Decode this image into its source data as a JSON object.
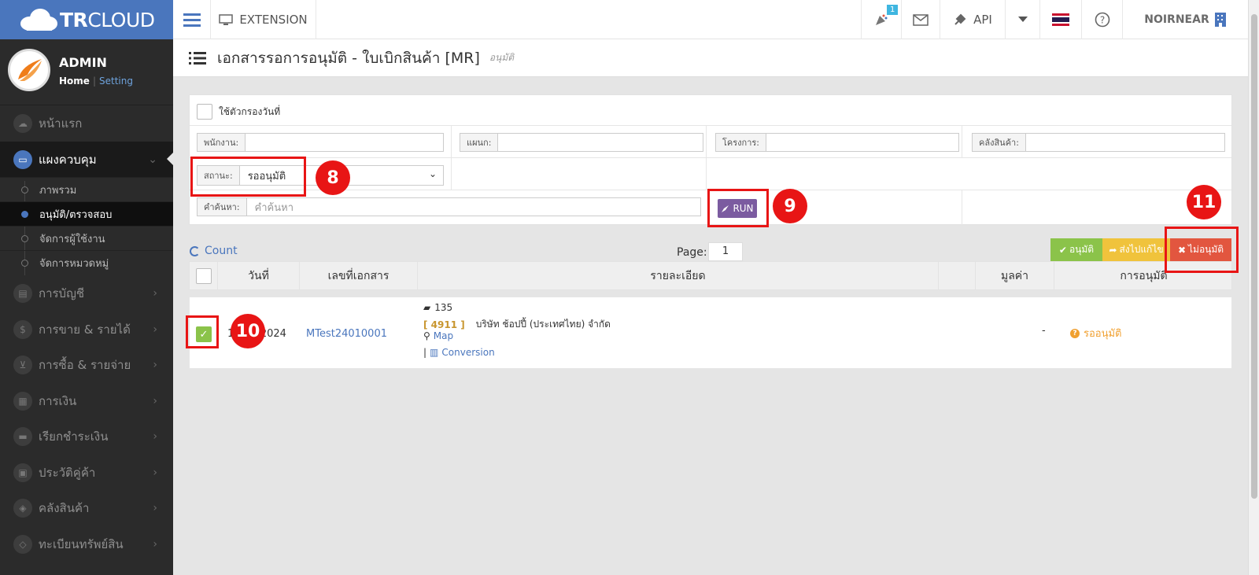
{
  "brand": {
    "prefix": "TR",
    "suffix": "CLOUD"
  },
  "topbar": {
    "extension_label": "EXTENSION",
    "notification_count": "1",
    "api_label": "API",
    "user_label": "NOIRNEAR"
  },
  "profile": {
    "name": "ADMIN",
    "home": "Home",
    "separator": "|",
    "setting": "Setting"
  },
  "sidebar": {
    "items": [
      {
        "label": "หน้าแรก",
        "icon": "cloud-icon"
      },
      {
        "label": "แผงควบคุม",
        "icon": "monitor-icon"
      },
      {
        "label": "การบัญชี",
        "icon": "book-icon"
      },
      {
        "label": "การขาย & รายได้",
        "icon": "dollar-icon"
      },
      {
        "label": "การซื้อ & รายจ่าย",
        "icon": "cart-icon"
      },
      {
        "label": "การเงิน",
        "icon": "calendar-icon"
      },
      {
        "label": "เรียกชำระเงิน",
        "icon": "credit-card-icon"
      },
      {
        "label": "ประวัติคู่ค้า",
        "icon": "address-book-icon"
      },
      {
        "label": "คลังสินค้า",
        "icon": "cubes-icon"
      },
      {
        "label": "ทะเบียนทรัพย์สิน",
        "icon": "diamond-icon"
      }
    ],
    "sub_items": [
      "ภาพรวม",
      "อนุมัติ/ตรวจสอบ",
      "จัดการผู้ใช้งาน",
      "จัดการหมวดหมู่"
    ]
  },
  "page": {
    "title": "เอกสารรอการอนุมัติ - ใบเบิกสินค้า [MR]",
    "subtitle": "อนุมัติ"
  },
  "filters": {
    "date_filter_label": "ใช้ตัวกรองวันที่",
    "employee_label": "พนักงาน:",
    "department_label": "แผนก:",
    "project_label": "โครงการ:",
    "warehouse_label": "คลังสินค้า:",
    "status_label": "สถานะ:",
    "status_value": "รออนุมัติ",
    "search_label": "คำค้นหา:",
    "search_placeholder": "คำค้นหา",
    "run_label": "RUN"
  },
  "list": {
    "count_label": "Count",
    "page_label": "Page:",
    "page_value": "1",
    "actions": {
      "approve": "อนุมัติ",
      "return": "ส่งไปแก้ไข",
      "reject": "ไม่อนุมัติ"
    },
    "columns": [
      "วันที่",
      "เลขที่เอกสาร",
      "รายละเอียด",
      "มูลค่า",
      "การอนุมัติ"
    ],
    "rows": [
      {
        "date": "10/01/2024",
        "doc_no": "MTest24010001",
        "book_no": "135",
        "code": "[ 4911 ]",
        "company": "บริษัท ช้อปปี้ (ประเทศไทย) จำกัด",
        "map": "Map",
        "conversion_prefix": "|",
        "conversion": "Conversion",
        "value": "-",
        "status": "รออนุมัติ"
      }
    ]
  },
  "annotations": [
    "8",
    "9",
    "10",
    "11"
  ],
  "colors": {
    "brand": "#4a76bd",
    "approve": "#8bc34a",
    "return": "#f0c33c",
    "reject": "#e2563f",
    "run": "#7b5ba0",
    "annotation": "#e81515"
  }
}
